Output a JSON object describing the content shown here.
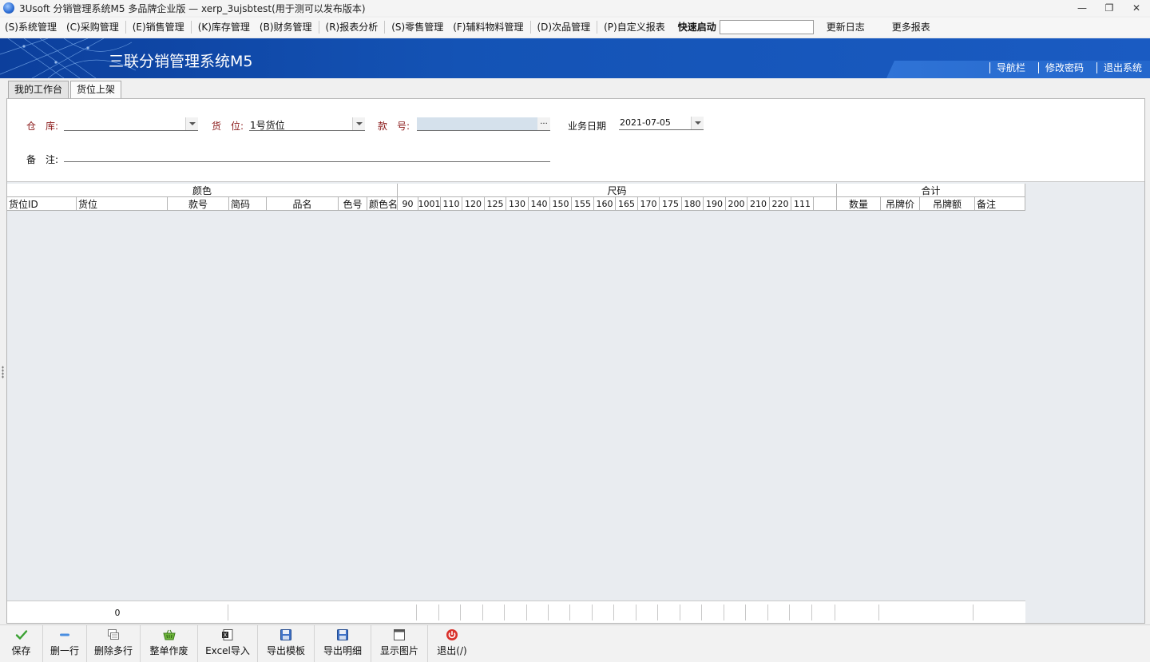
{
  "window": {
    "title": "3Usoft 分销管理系统M5 多品牌企业版 — xerp_3ujsbtest(用于测可以发布版本)",
    "controls": [
      "—",
      "❐",
      "✕"
    ]
  },
  "menu": {
    "items": [
      {
        "label": "(S)系统管理"
      },
      {
        "label": "(C)采购管理"
      },
      {
        "label": "(E)销售管理"
      },
      {
        "label": "(K)库存管理"
      },
      {
        "label": "(B)财务管理"
      },
      {
        "label": "(R)报表分析"
      },
      {
        "label": "(S)零售管理"
      },
      {
        "label": "(F)辅料物料管理"
      },
      {
        "label": "(D)次品管理"
      },
      {
        "label": "(P)自定义报表"
      }
    ],
    "quick_launch_label": "快速启动",
    "quick_launch_value": "",
    "update_log": "更新日志",
    "more_reports": "更多报表"
  },
  "banner": {
    "brand": "三联分销管理系统M5",
    "links": [
      "导航栏",
      "修改密码",
      "退出系统"
    ]
  },
  "tabs": [
    {
      "label": "我的工作台",
      "active": false
    },
    {
      "label": "货位上架",
      "active": true
    }
  ],
  "form": {
    "warehouse_label": "仓　库:",
    "warehouse_value": "",
    "location_label": "货　位:",
    "location_value": "1号货位",
    "style_label": "款　号:",
    "style_value": "",
    "date_label": "业务日期",
    "date_value": "2021-07-05",
    "remark_label": "备　注:",
    "remark_value": ""
  },
  "grid": {
    "group_headers": [
      "颜色",
      "尺码",
      "合计"
    ],
    "columns": [
      "货位ID",
      "货位",
      "款号",
      "简码",
      "品名",
      "色号",
      "颜色名"
    ],
    "sizes": [
      "90",
      "1001",
      "110",
      "120",
      "125",
      "130",
      "140",
      "150",
      "155",
      "160",
      "165",
      "170",
      "175",
      "180",
      "190",
      "200",
      "210",
      "220",
      "111",
      ""
    ],
    "total_columns": [
      "数量",
      "吊牌价",
      "吊牌额",
      "备注"
    ],
    "footer_count": "0"
  },
  "toolbar": {
    "buttons": [
      {
        "label": "保存",
        "icon": "check-icon"
      },
      {
        "label": "删一行",
        "icon": "minus-icon"
      },
      {
        "label": "删除多行",
        "icon": "multi-delete-icon"
      },
      {
        "label": "整单作废",
        "icon": "basket-icon"
      },
      {
        "label": "Excel导入",
        "icon": "excel-import-icon"
      },
      {
        "label": "导出模板",
        "icon": "floppy-icon"
      },
      {
        "label": "导出明细",
        "icon": "floppy-icon"
      },
      {
        "label": "显示图片",
        "icon": "window-icon"
      },
      {
        "label": "退出(/)",
        "icon": "power-icon"
      }
    ]
  },
  "colors": {
    "banner": "#1453b5",
    "label_red": "#8b1a1a",
    "grid_bg": "#e9ecf0",
    "style_field_bg": "#d5e1ec"
  }
}
